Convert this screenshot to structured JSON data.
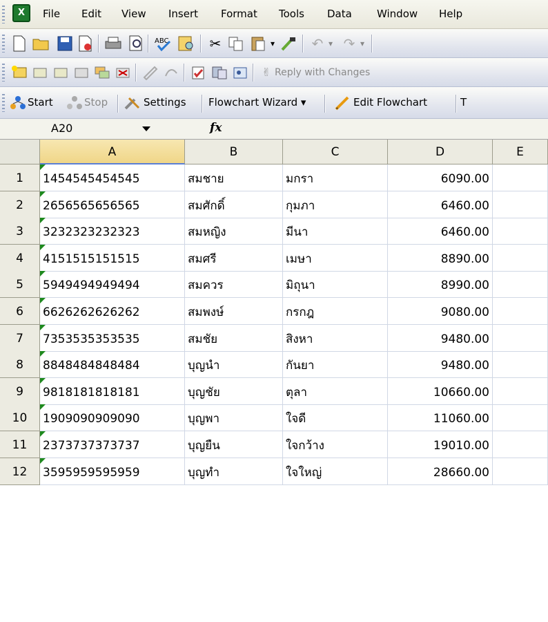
{
  "menu": [
    "File",
    "Edit",
    "View",
    "Insert",
    "Format",
    "Tools",
    "Data",
    "Window",
    "Help"
  ],
  "toolbar_review": {
    "reply_label": "Reply with Changes"
  },
  "toolbar_flow": {
    "start": "Start",
    "stop": "Stop",
    "settings": "Settings",
    "wizard": "Flowchart Wizard ▾",
    "edit": "Edit Flowchart",
    "trailing": "T"
  },
  "formula_bar": {
    "name_box": "A20",
    "fx": "fx",
    "content": ""
  },
  "sheet": {
    "columns": [
      "A",
      "B",
      "C",
      "D",
      "E"
    ],
    "rows": [
      {
        "n": "1",
        "a": "1454545454545",
        "b": "สมชาย",
        "c": "มกรา",
        "d": "6090.00"
      },
      {
        "n": "2",
        "a": "2656565656565",
        "b": "สมศักดิ์",
        "c": "กุมภา",
        "d": "6460.00"
      },
      {
        "n": "3",
        "a": "3232323232323",
        "b": "สมหญิง",
        "c": "มีนา",
        "d": "6460.00"
      },
      {
        "n": "4",
        "a": "4151515151515",
        "b": "สมศรี",
        "c": "เมษา",
        "d": "8890.00"
      },
      {
        "n": "5",
        "a": "5949494949494",
        "b": "สมควร",
        "c": "มิถุนา",
        "d": "8990.00"
      },
      {
        "n": "6",
        "a": "6626262626262",
        "b": "สมพงษ์",
        "c": "กรกฎ",
        "d": "9080.00"
      },
      {
        "n": "7",
        "a": "7353535353535",
        "b": "สมชัย",
        "c": "สิงหา",
        "d": "9480.00"
      },
      {
        "n": "8",
        "a": "8848484848484",
        "b": "บุญนำ",
        "c": "กันยา",
        "d": "9480.00"
      },
      {
        "n": "9",
        "a": "9818181818181",
        "b": "บุญชัย",
        "c": "ตุลา",
        "d": "10660.00"
      },
      {
        "n": "10",
        "a": "1909090909090",
        "b": "บุญพา",
        "c": "ใจดี",
        "d": "11060.00"
      },
      {
        "n": "11",
        "a": "2373737373737",
        "b": "บุญยืน",
        "c": "ใจกว้าง",
        "d": "19010.00"
      },
      {
        "n": "12",
        "a": "3595959595959",
        "b": "บุญทำ",
        "c": "ใจใหญ่",
        "d": "28660.00"
      }
    ]
  },
  "colors": {
    "accent_selected_header": "#f0d688",
    "number_tag": "#1e8a1e"
  }
}
